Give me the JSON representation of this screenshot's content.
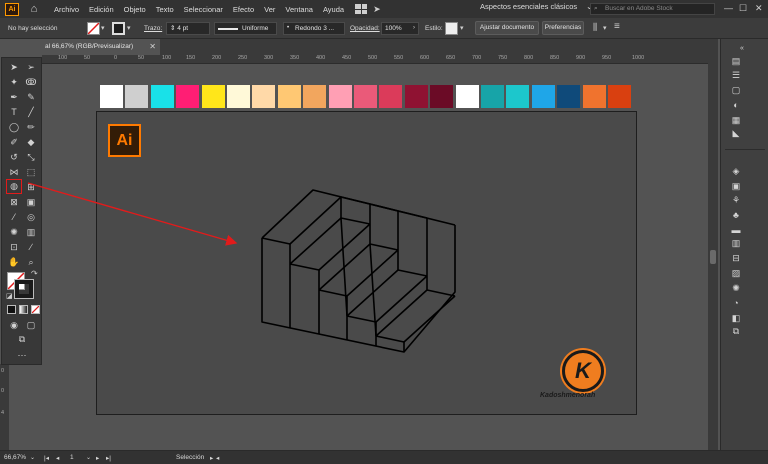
{
  "app": {
    "logo": "Ai"
  },
  "menubar": {
    "items": [
      "Archivo",
      "Edición",
      "Objeto",
      "Texto",
      "Seleccionar",
      "Efecto",
      "Ver",
      "Ventana",
      "Ayuda"
    ],
    "workspace": "Aspectos esenciales clásicos",
    "search_placeholder": "Buscar en Adobe Stock"
  },
  "control": {
    "selection": "No hay selección",
    "stroke_label": "Trazo:",
    "stroke_value": "4 pt",
    "profile": "Uniforme",
    "brush": "Redondo 3 ...",
    "opacity_label": "Opacidad:",
    "opacity_value": "100%",
    "style_label": "Estilo:",
    "doc_button": "Ajustar documento",
    "prefs_button": "Preferencias"
  },
  "document": {
    "tab_title": "al 66,67% (RGB/Previsualizar)"
  },
  "ruler": {
    "ticks": [
      "100",
      "50",
      "0",
      "50",
      "100",
      "150",
      "200",
      "250",
      "300",
      "350",
      "400",
      "450",
      "500",
      "550",
      "600",
      "650",
      "700",
      "750",
      "800",
      "850",
      "900",
      "950",
      "1000"
    ]
  },
  "ruler_left": {
    "ticks": [
      "0",
      "0",
      "4"
    ]
  },
  "swatches": [
    "#ffffff",
    "#cfcfcf",
    "#19e1e8",
    "#ff1e74",
    "#ffe61a",
    "#fff9d8",
    "#ffd9a8",
    "#ffc873",
    "#f2a65e",
    "#ff9fb4",
    "#ea5a79",
    "#db3b5a",
    "#8f1232",
    "#6b0b26",
    "#ffffff",
    "#17a4a8",
    "#1cc7cc",
    "#1fa6e8",
    "#0f4a7a",
    "#f0732e",
    "#d94010"
  ],
  "artwork": {
    "logo_text": "Ai",
    "brand_letter": "K",
    "brand_name": "Kadoshmenorah",
    "colors": {
      "ai_orange": "#ff7a00",
      "brand_orange": "#ef7d1f",
      "arrow_red": "#e21b1b",
      "stroke": "#000000"
    }
  },
  "statusbar": {
    "zoom": "66,67%",
    "artboard": "1",
    "tool": "Selección"
  }
}
